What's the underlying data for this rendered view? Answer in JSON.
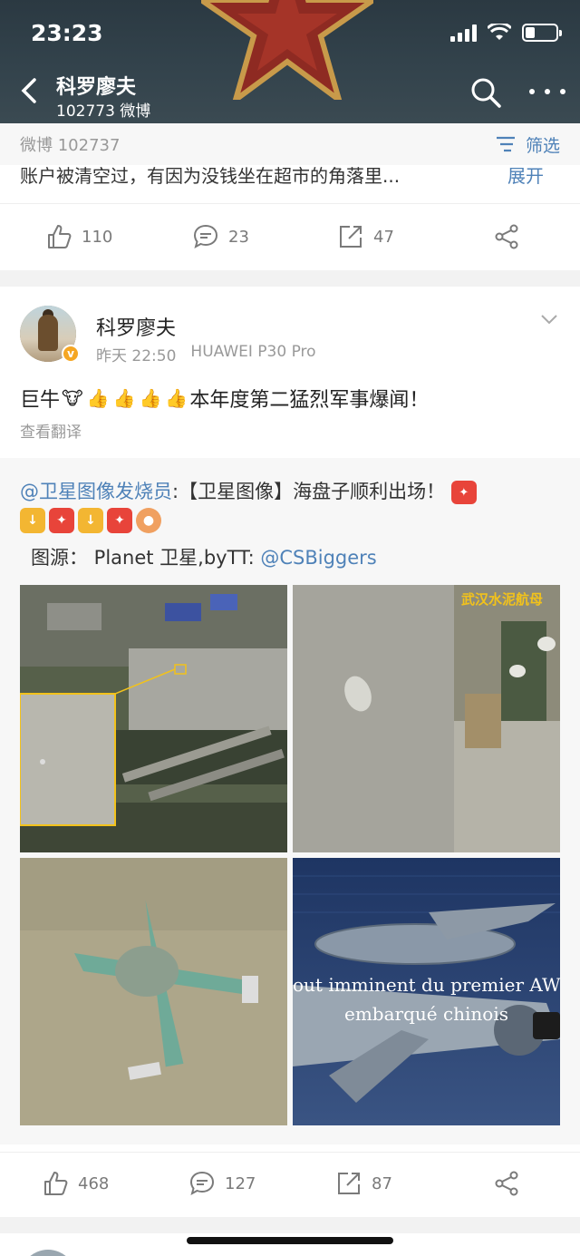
{
  "status_bar": {
    "time": "23:23"
  },
  "header": {
    "title": "科罗廖夫",
    "subtitle": "102773 微博"
  },
  "filter_bar": {
    "count": "微博 102737",
    "filter_label": "筛选"
  },
  "prev_post": {
    "truncated_text": "账户被清空过，有因为没钱坐在超市的角落里...",
    "expand_label": "展开",
    "likes": "110",
    "comments": "23",
    "reposts": "47"
  },
  "post": {
    "author": "科罗廖夫",
    "time": "昨天 22:50",
    "device": "HUAWEI P30 Pro",
    "text_prefix": "巨牛",
    "text_suffix": "本年度第二猛烈军事爆闻！",
    "translate_label": "查看翻译",
    "repost": {
      "mention": "@卫星图像发烧员",
      "text": ":【卫星图像】海盘子顺利出场！",
      "source_prefix": "图源： Planet 卫星,byTT: ",
      "source_mention": "@CSBiggers",
      "image2_caption": "武汉水泥航母",
      "image4_caption_line1": "out imminent du premier AW",
      "image4_caption_line2": "embarqué chinois"
    },
    "likes": "468",
    "comments": "127",
    "reposts": "87"
  },
  "colors": {
    "link": "#4f82b8",
    "accent": "#f5a623"
  }
}
